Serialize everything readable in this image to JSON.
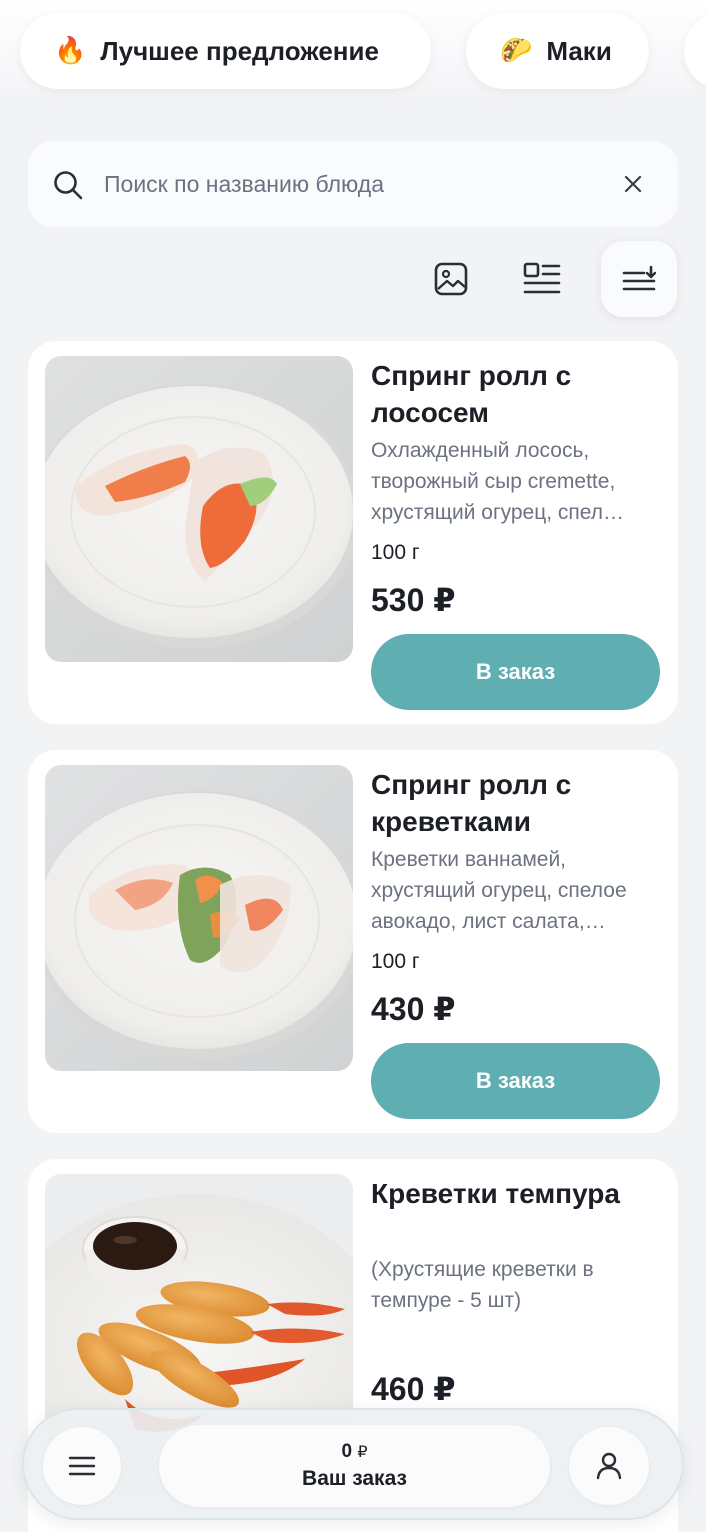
{
  "categories": [
    {
      "emoji": "🔥",
      "label": "Лучшее предложение",
      "icon": "fire-icon"
    },
    {
      "emoji": "🌮",
      "label": "Маки",
      "icon": "taco-icon"
    },
    {
      "emoji": "",
      "label": "",
      "icon": ""
    }
  ],
  "search": {
    "placeholder": "Поиск по названию блюда",
    "value": ""
  },
  "view_modes": [
    "grid-view-icon",
    "list-view-icon",
    "sort-icon"
  ],
  "products": [
    {
      "title": "Спринг ролл с лососем",
      "description": "Охлажденный лосось, творожный сыр cremette, хрустящий огурец, спел…",
      "weight": "100 г",
      "price": "530 ₽",
      "button": "В заказ"
    },
    {
      "title": "Спринг ролл с креветками",
      "description": "Креветки ваннамей, хрустящий огурец, спелое авокадо, лист салата,…",
      "weight": "100 г",
      "price": "430 ₽",
      "button": "В заказ"
    },
    {
      "title": "Креветки темпура",
      "description": "(Хрустящие креветки в темпуре - 5 шт)",
      "weight": "",
      "price": "460 ₽",
      "button": ""
    }
  ],
  "bottom_bar": {
    "amount": "0",
    "currency": "₽",
    "label": "Ваш заказ"
  },
  "colors": {
    "accent": "#5faeb2",
    "background": "#f2f3f5",
    "text": "#1c1f26",
    "muted": "#6c7280"
  }
}
